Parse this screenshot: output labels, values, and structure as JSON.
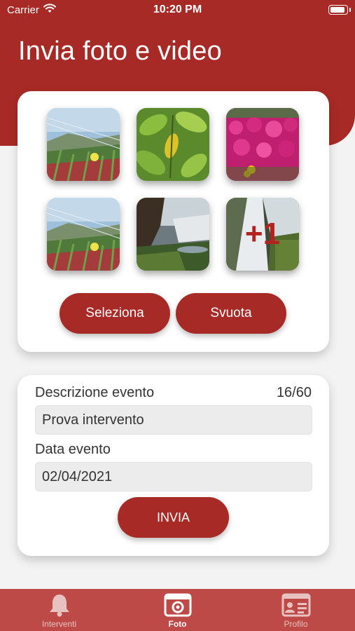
{
  "status_bar": {
    "carrier": "Carrier",
    "time": "10:20 PM"
  },
  "header": {
    "title": "Invia foto e video"
  },
  "photos": {
    "items": [
      {
        "subject": "grass-and-flower-photo"
      },
      {
        "subject": "leaves-photo"
      },
      {
        "subject": "pink-flowers-photo"
      },
      {
        "subject": "grass-and-flower-photo"
      },
      {
        "subject": "waterfall-photo"
      },
      {
        "subject": "waterfall-photo"
      }
    ],
    "more_count_label": "+1"
  },
  "buttons": {
    "select_label": "Seleziona",
    "clear_label": "Svuota",
    "send_label": "INVIA"
  },
  "form": {
    "description_label": "Descrizione evento",
    "description_counter": "16/60",
    "description_value": "Prova intervento",
    "date_label": "Data evento",
    "date_value": "02/04/2021"
  },
  "tabbar": {
    "tabs": [
      {
        "label": "Interventi",
        "icon": "bell-icon"
      },
      {
        "label": "Foto",
        "icon": "camera-icon",
        "active": true
      },
      {
        "label": "Profilo",
        "icon": "id-card-icon"
      }
    ]
  },
  "colors": {
    "accent": "#a82a27",
    "tabbar": "#bd4a46",
    "background": "#f3f3f3"
  }
}
